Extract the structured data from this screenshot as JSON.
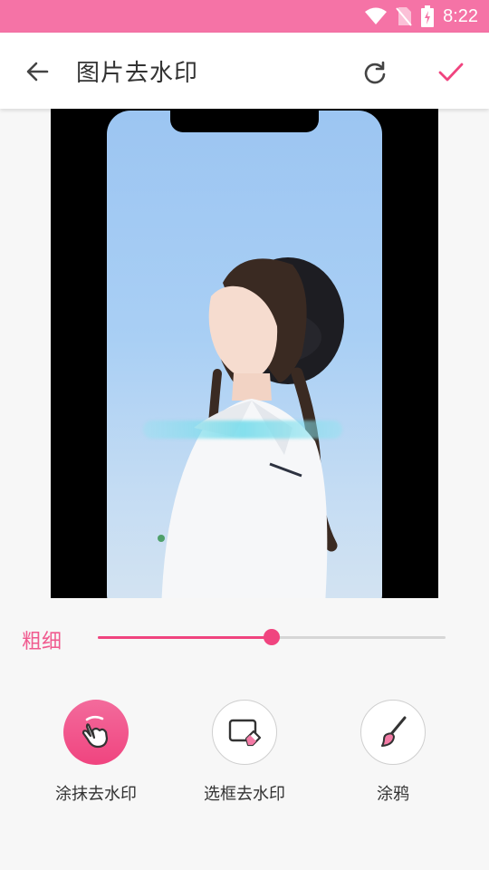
{
  "status_bar": {
    "time": "8:22",
    "color": "#f573a6"
  },
  "app_bar": {
    "title": "图片去水印",
    "back_icon": "arrow-left-icon",
    "refresh_icon": "refresh-icon",
    "confirm_icon": "check-icon",
    "accent": "#f0447f"
  },
  "image": {
    "watermark_text": ""
  },
  "slider": {
    "label": "粗细",
    "value": 0.5
  },
  "tools": [
    {
      "label": "涂抹去水印",
      "icon": "hand-smear-icon",
      "active": true
    },
    {
      "label": "选框去水印",
      "icon": "select-box-eraser-icon",
      "active": false
    },
    {
      "label": "涂鸦",
      "icon": "brush-icon",
      "active": false
    }
  ]
}
